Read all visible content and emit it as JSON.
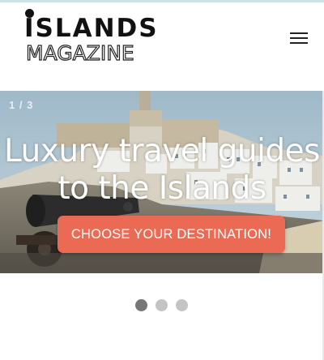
{
  "header": {
    "logo_line1": "ISLANDS",
    "logo_line2": "MAGAZINE",
    "menu_icon": "hamburger-menu-icon"
  },
  "hero": {
    "slide_counter": "1 / 3",
    "title": "Luxury travel guides to the Islands",
    "cta_label": "CHOOSE YOUR DESTINATION!"
  },
  "carousel": {
    "total_slides": 3,
    "active_index": 0
  },
  "colors": {
    "cta": "#ea6a54",
    "dot_active": "#777777",
    "dot_inactive": "#c4c4c4",
    "top_rule": "#cfe3e2"
  }
}
